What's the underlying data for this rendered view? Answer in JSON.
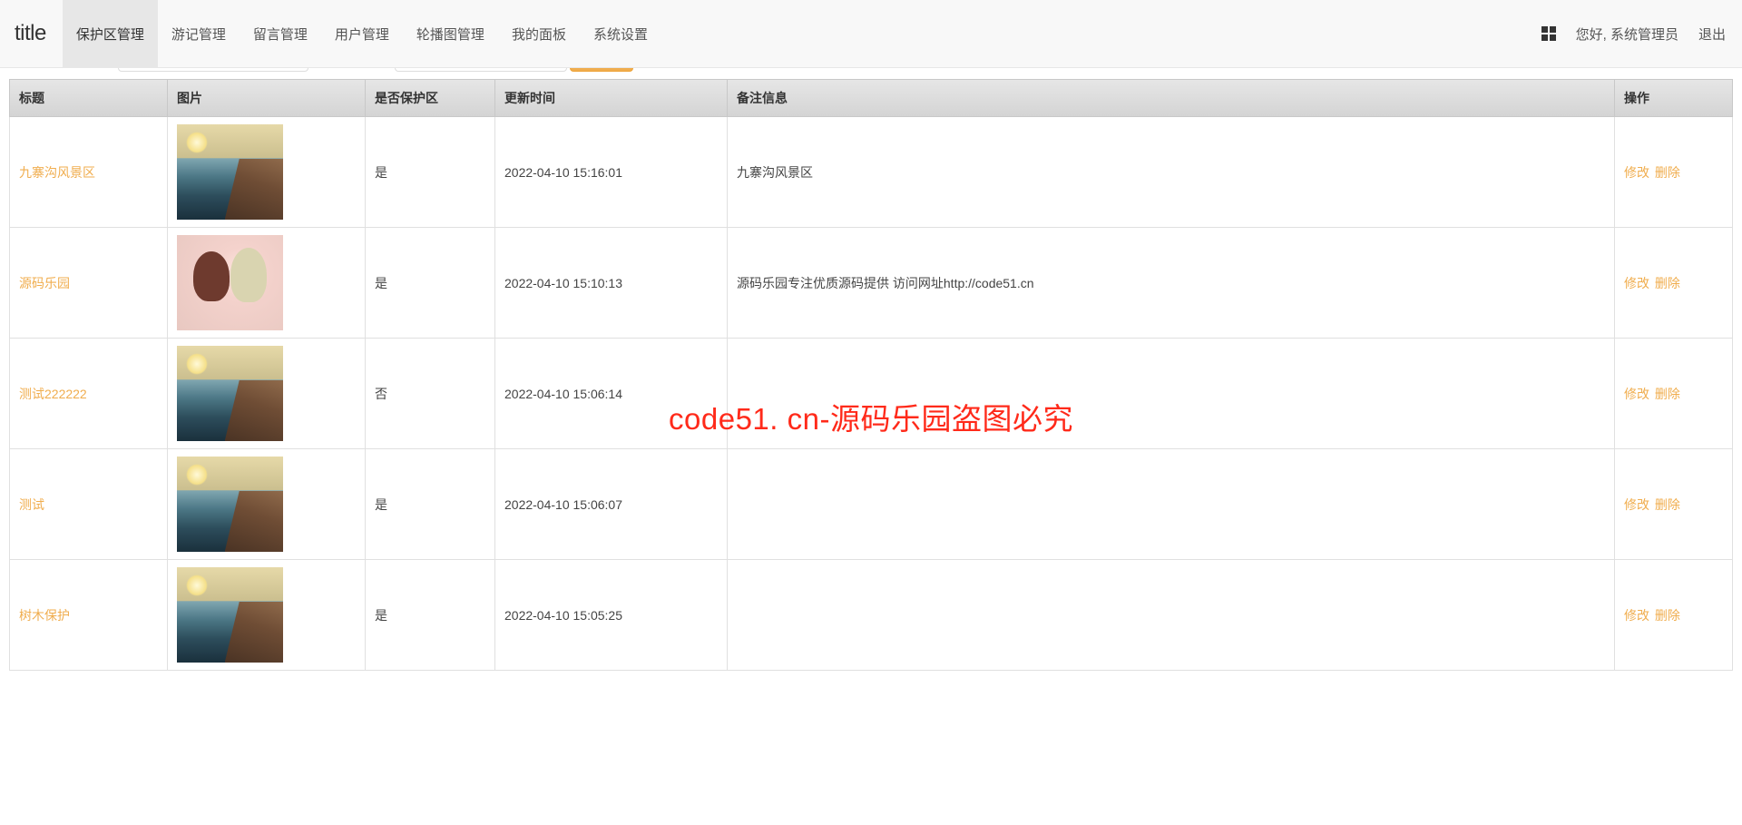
{
  "header": {
    "brand": "title",
    "nav": [
      "保护区管理",
      "游记管理",
      "留言管理",
      "用户管理",
      "轮播图管理",
      "我的面板",
      "系统设置"
    ],
    "active_index": 0,
    "greeting": "您好, 系统管理员",
    "logout": "退出"
  },
  "table": {
    "columns": [
      "标题",
      "图片",
      "是否保护区",
      "更新时间",
      "备注信息",
      "操作"
    ],
    "op_edit": "修改",
    "op_delete": "删除",
    "rows": [
      {
        "title": "九寨沟风景区",
        "image": "land",
        "protected": "是",
        "updated": "2022-04-10 15:16:01",
        "remark": "九寨沟风景区"
      },
      {
        "title": "源码乐园",
        "image": "anime",
        "protected": "是",
        "updated": "2022-04-10 15:10:13",
        "remark": "源码乐园专注优质源码提供 访问网址http://code51.cn"
      },
      {
        "title": "测试222222",
        "image": "land",
        "protected": "否",
        "updated": "2022-04-10 15:06:14",
        "remark": ""
      },
      {
        "title": "测试",
        "image": "land",
        "protected": "是",
        "updated": "2022-04-10 15:06:07",
        "remark": ""
      },
      {
        "title": "树木保护",
        "image": "land",
        "protected": "是",
        "updated": "2022-04-10 15:05:25",
        "remark": ""
      }
    ]
  },
  "watermark": "code51. cn-源码乐园盗图必究"
}
